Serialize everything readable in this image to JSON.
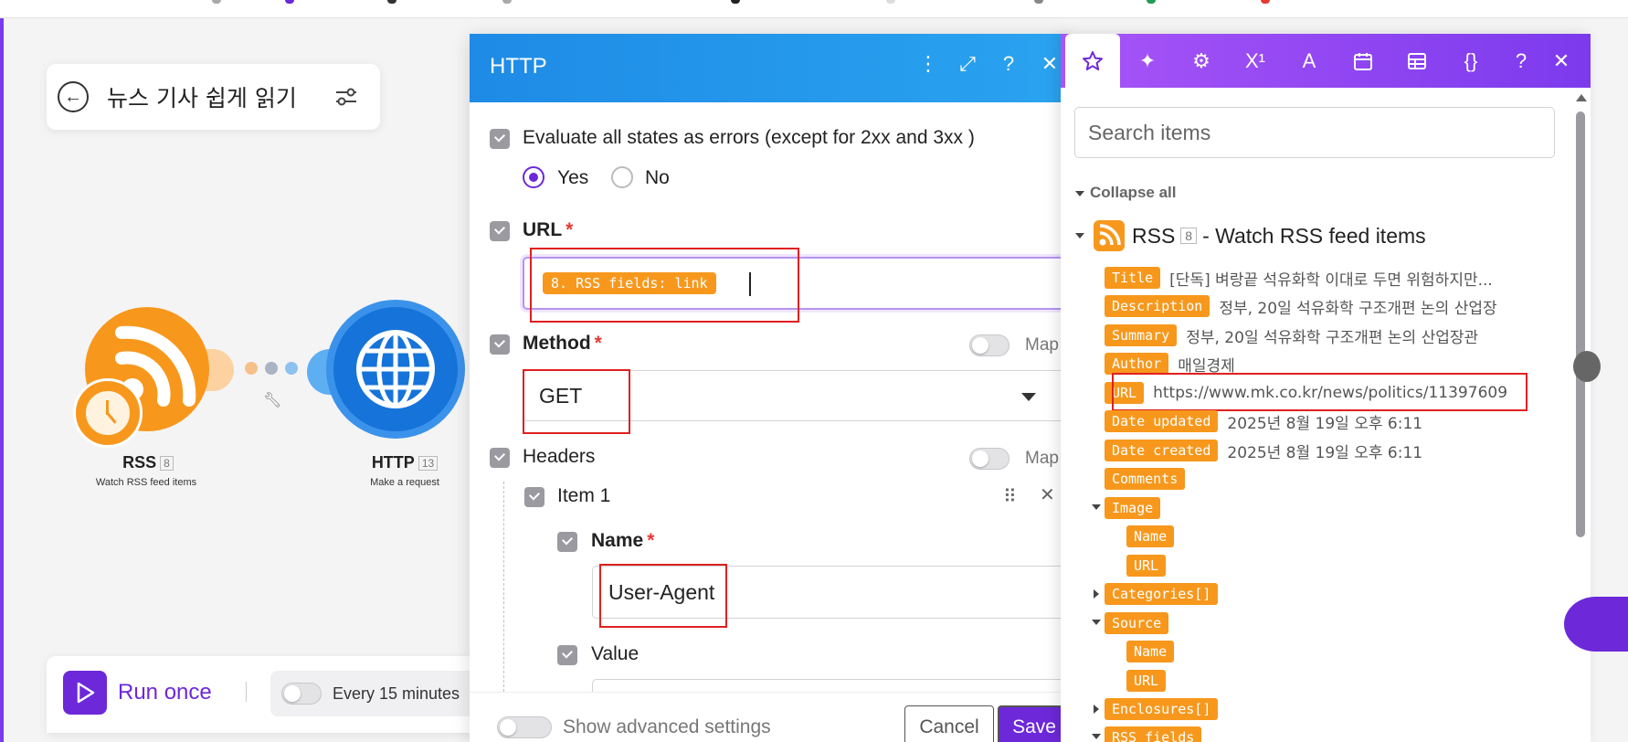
{
  "scenario": {
    "title": "뉴스 기사 쉽게 읽기"
  },
  "canvas": {
    "modules": [
      {
        "name": "RSS",
        "badge": "8",
        "subtitle": "Watch RSS feed items",
        "color": "#f7981d"
      },
      {
        "name": "HTTP",
        "badge": "13",
        "subtitle": "Make a request",
        "color": "#1673d9"
      }
    ],
    "run_once_label": "Run once",
    "schedule_label": "Every 15 minutes"
  },
  "dialog": {
    "title": "HTTP",
    "evaluate_label": "Evaluate all states as errors (except for 2xx and 3xx )",
    "evaluate_options": {
      "yes": "Yes",
      "no": "No",
      "selected": "Yes"
    },
    "url_label": "URL",
    "url_required": "*",
    "url_value_pill": "8. RSS fields: link",
    "method_label": "Method",
    "method_required": "*",
    "method_value": "GET",
    "map_label": "Map",
    "headers_label": "Headers",
    "item_label": "Item 1",
    "name_label": "Name",
    "name_required": "*",
    "name_value": "User-Agent",
    "value_label": "Value",
    "show_advanced_label": "Show advanced settings",
    "cancel_label": "Cancel",
    "save_label": "Save"
  },
  "panel": {
    "tabs": [
      "star-icon",
      "sparkle-icon",
      "gear-icon",
      "superscript-icon",
      "text-icon",
      "calendar-icon",
      "table-icon",
      "braces-icon",
      "help-icon",
      "close-icon"
    ],
    "tab_glyphs": {
      "superscript": "X¹",
      "text": "A",
      "braces": "{}",
      "help": "?",
      "close": "✕"
    },
    "search_placeholder": "Search items",
    "collapse_all": "Collapse all",
    "source_name": "RSS",
    "source_badge": "8",
    "source_desc": "- Watch RSS feed items",
    "fields": [
      {
        "tag": "Title",
        "value": "[단독] 벼랑끝 석유화학 이대로 두면 위험하지만..."
      },
      {
        "tag": "Description",
        "value": "정부, 20일 석유화학 구조개편 논의 산업장"
      },
      {
        "tag": "Summary",
        "value": "정부, 20일 석유화학 구조개편 논의 산업장관"
      },
      {
        "tag": "Author",
        "value": "매일경제"
      },
      {
        "tag": "URL",
        "value": "https://www.mk.co.kr/news/politics/11397609"
      },
      {
        "tag": "Date updated",
        "value": "2025년 8월 19일 오후 6:11"
      },
      {
        "tag": "Date created",
        "value": "2025년 8월 19일 오후 6:11"
      },
      {
        "tag": "Comments",
        "value": ""
      },
      {
        "tag": "Image",
        "value": ""
      },
      {
        "tag": "Name",
        "value": ""
      },
      {
        "tag": "URL",
        "value": ""
      },
      {
        "tag": "Categories[]",
        "value": ""
      },
      {
        "tag": "Source",
        "value": ""
      },
      {
        "tag": "Name",
        "value": ""
      },
      {
        "tag": "URL",
        "value": ""
      },
      {
        "tag": "Enclosures[]",
        "value": ""
      },
      {
        "tag": "RSS fields",
        "value": ""
      }
    ]
  },
  "colors": {
    "accent": "#6d28d9",
    "http_header": "#1e8be6",
    "panel_header": "#a855f7",
    "rss_orange": "#f7981d",
    "highlight_red": "#e02020"
  }
}
